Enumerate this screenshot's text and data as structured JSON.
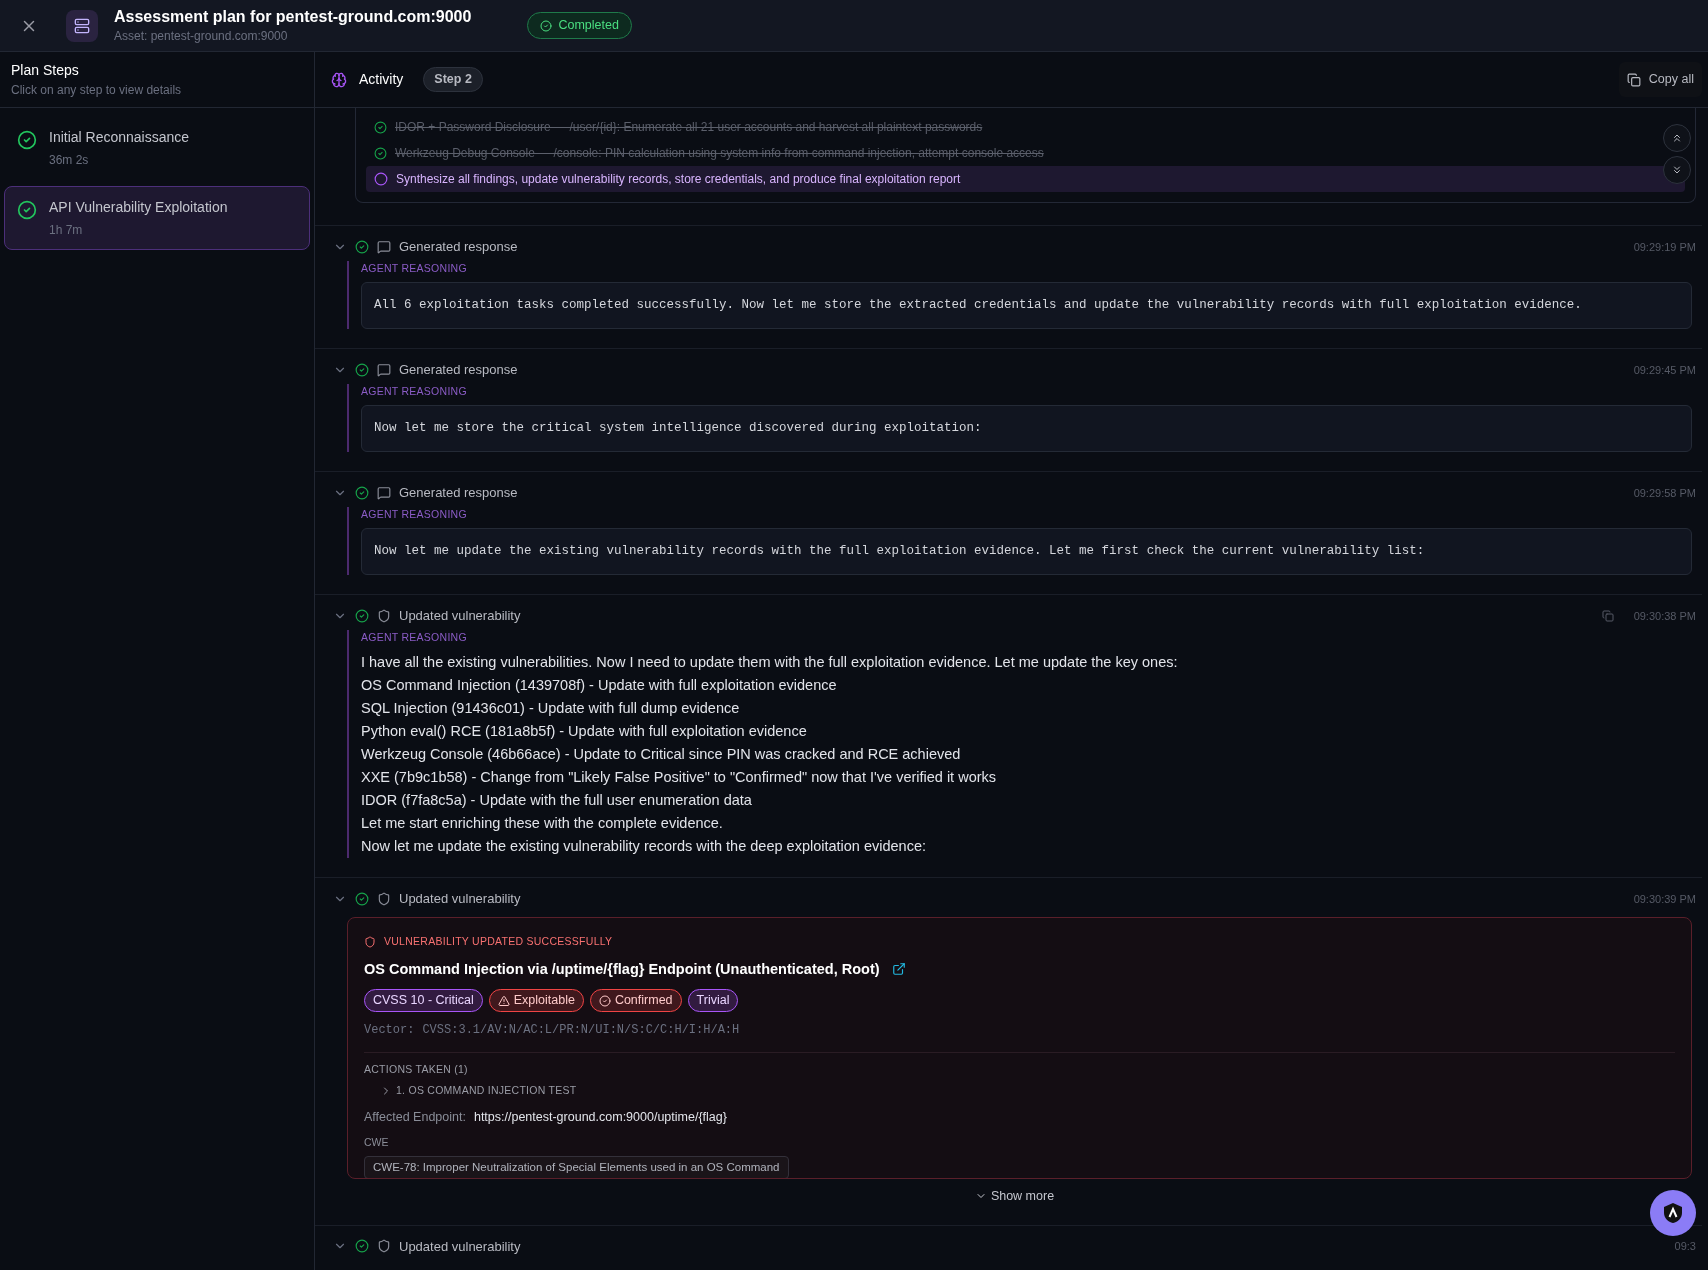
{
  "header": {
    "title": "Assessment plan for pentest-ground.com:9000",
    "asset": "Asset: pentest-ground.com:9000",
    "status": {
      "label": "Completed",
      "done": true
    }
  },
  "sidebar": {
    "title": "Plan Steps",
    "subtitle": "Click on any step to view details",
    "steps": [
      {
        "name": "Initial Reconnaissance",
        "duration": "36m 2s",
        "done": true,
        "selected": false
      },
      {
        "name": "API Vulnerability Exploitation",
        "duration": "1h 7m",
        "done": true,
        "selected": true
      }
    ]
  },
  "activity": {
    "title": "Activity",
    "step_badge": "Step 2",
    "copy_button": "Copy all",
    "tasks": [
      {
        "text": "IDOR + Password Disclosure — /user/{id}: Enumerate all 21 user accounts and harvest all plaintext passwords",
        "done": true
      },
      {
        "text": "Werkzeug Debug Console — /console: PIN calculation using system info from command injection, attempt console access",
        "done": true
      },
      {
        "text": "Synthesize all findings, update vulnerability records, store credentials, and produce final exploitation report",
        "done": false
      }
    ],
    "entries": [
      {
        "kind": "response",
        "title": "Generated response",
        "time": "09:29:19 PM",
        "done": true,
        "copyable": false,
        "body": {
          "kind": "mono",
          "label": "AGENT REASONING",
          "text": "All 6 exploitation tasks completed successfully. Now let me store the extracted credentials and update the vulnerability records with full exploitation evidence."
        }
      },
      {
        "kind": "response",
        "title": "Generated response",
        "time": "09:29:45 PM",
        "done": true,
        "copyable": false,
        "body": {
          "kind": "mono",
          "label": "AGENT REASONING",
          "text": "Now let me store the critical system intelligence discovered during exploitation:"
        }
      },
      {
        "kind": "response",
        "title": "Generated response",
        "time": "09:29:58 PM",
        "done": true,
        "copyable": false,
        "body": {
          "kind": "mono",
          "label": "AGENT REASONING",
          "text": "Now let me update the existing vulnerability records with the full exploitation evidence. Let me first check the current vulnerability list:"
        }
      },
      {
        "kind": "vulnerability",
        "title": "Updated vulnerability",
        "time": "09:30:38 PM",
        "done": true,
        "copyable": true,
        "body": {
          "kind": "lines",
          "label": "AGENT REASONING",
          "lines": [
            "I have all the existing vulnerabilities. Now I need to update them with the full exploitation evidence. Let me update the key ones:",
            "OS Command Injection (1439708f) - Update with full exploitation evidence",
            "SQL Injection (91436c01) - Update with full dump evidence",
            "Python eval() RCE (181a8b5f) - Update with full exploitation evidence",
            "Werkzeug Console (46b66ace) - Update to Critical since PIN was cracked and RCE achieved",
            "XXE (7b9c1b58) - Change from \"Likely False Positive\" to \"Confirmed\" now that I've verified it works",
            "IDOR (f7fa8c5a) - Update with the full user enumeration data",
            "Let me start enriching these with the complete evidence.",
            "Now let me update the existing vulnerability records with the deep exploitation evidence:"
          ]
        }
      },
      {
        "kind": "vulnerability",
        "title": "Updated vulnerability",
        "time": "09:30:39 PM",
        "done": true,
        "copyable": false,
        "body": {
          "kind": "card",
          "banner": "VULNERABILITY UPDATED SUCCESSFULLY",
          "title": "OS Command Injection via /uptime/{flag} Endpoint (Unauthenticated, Root)",
          "tags": [
            {
              "label": "CVSS 10 - Critical",
              "kind": "plain",
              "color": "#a855f7"
            },
            {
              "label": "Exploitable",
              "kind": "warning",
              "color": "#ef4444"
            },
            {
              "label": "Confirmed",
              "kind": "check",
              "color": "#ef4444"
            },
            {
              "label": "Trivial",
              "kind": "plain",
              "color": "#a855f7"
            }
          ],
          "vector_label": "Vector:",
          "vector": "CVSS:3.1/AV:N/AC:L/PR:N/UI:N/S:C/C:H/I:H/A:H",
          "actions_heading": "ACTIONS TAKEN (1)",
          "actions": [
            {
              "text": "1. OS COMMAND INJECTION TEST",
              "expanded": false
            }
          ],
          "endpoint_label": "Affected Endpoint:",
          "endpoint": "https://pentest-ground.com:9000/uptime/{flag}",
          "cwe_label": "CWE",
          "cwe": "CWE-78: Improper Neutralization of Special Elements used in an OS Command",
          "show_more": "Show more"
        }
      },
      {
        "kind": "vulnerability",
        "title": "Updated vulnerability",
        "time": "09:3",
        "done": true,
        "copyable": false
      }
    ]
  }
}
